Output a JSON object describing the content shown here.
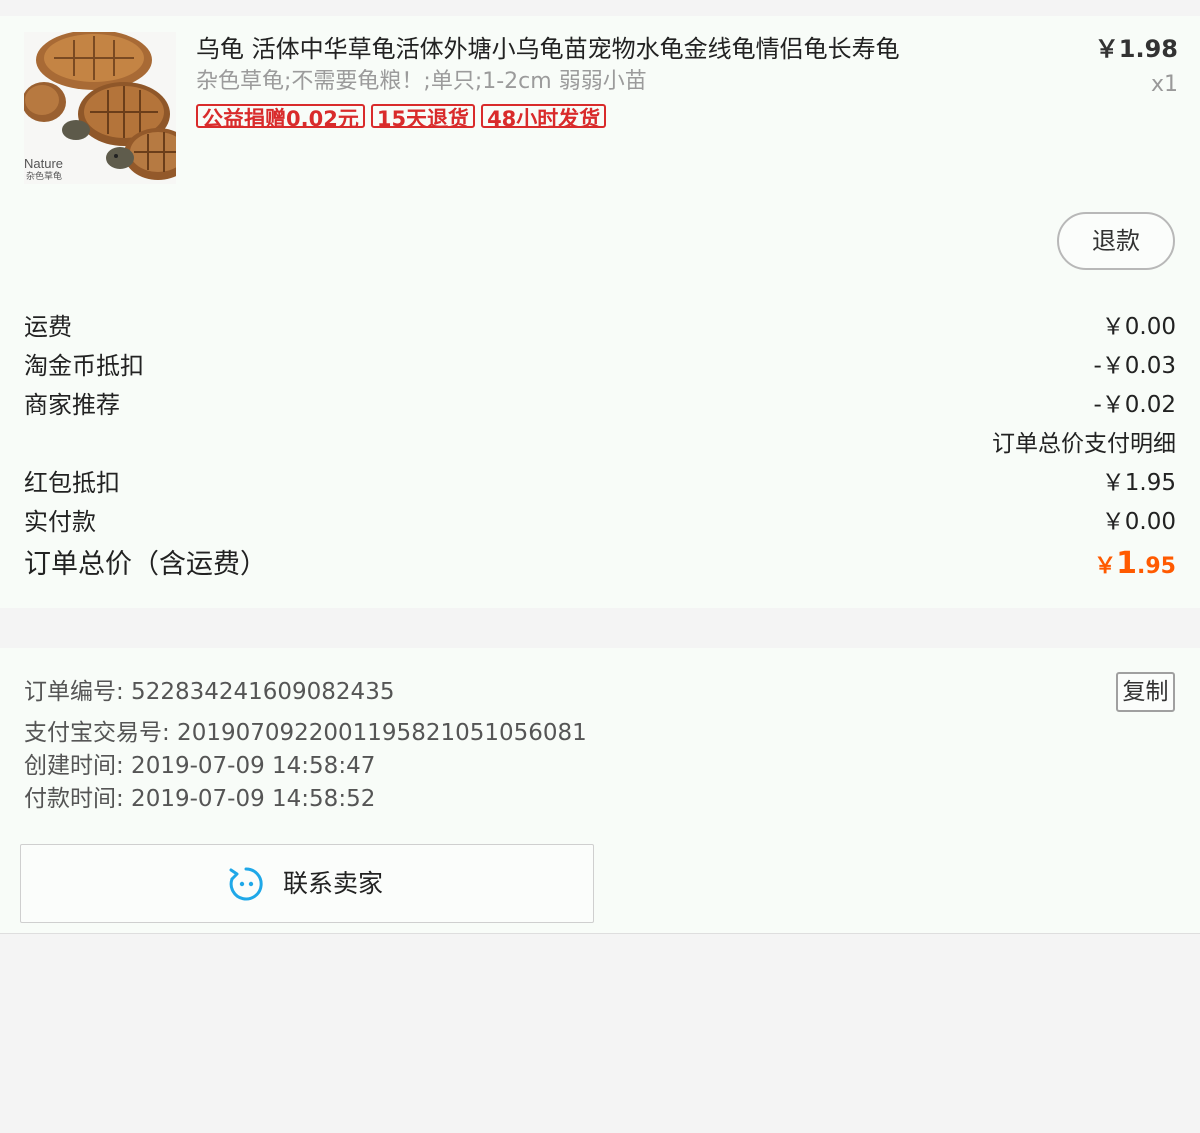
{
  "product": {
    "title": "乌龟 活体中华草龟活体外塘小乌龟苗宠物水龟金线龟情侣龟长寿龟",
    "sku": "杂色草龟;不需要龟粮！;单只;1-2cm 弱弱小苗",
    "tags": [
      "公益捐赠0.02元",
      "15天退货",
      "48小时发货"
    ],
    "price": "￥1.98",
    "quantity": "x1",
    "thumbnail_text": "Nature",
    "thumbnail_subtext": "杂色草龟",
    "refund_label": "退款"
  },
  "fees": {
    "shipping_label": "运费",
    "shipping_value": "￥0.00",
    "taojinbi_label": "淘金币抵扣",
    "taojinbi_value": "-￥0.03",
    "merchant_label": "商家推荐",
    "merchant_value": "-￥0.02",
    "detail_link": "订单总价支付明细",
    "redpacket_label": "红包抵扣",
    "redpacket_value": "￥1.95",
    "paid_label": "实付款",
    "paid_value": "￥0.00",
    "total_label": "订单总价（含运费）",
    "total_currency": "￥",
    "total_integer": "1",
    "total_decimal": ".95"
  },
  "order_info": {
    "order_number": "订单编号: 522834241609082435",
    "alipay_number": "支付宝交易号: 2019070922001195821051056081",
    "created_time": "创建时间: 2019-07-09 14:58:47",
    "paid_time": "付款时间: 2019-07-09 14:58:52",
    "copy_label": "复制",
    "contact_label": "联系卖家",
    "contact_icon": "chat-face-icon"
  },
  "colors": {
    "accent_price": "#ff5a00",
    "tag_red": "#d92b2b",
    "contact_icon_blue": "#1fa8e8"
  }
}
